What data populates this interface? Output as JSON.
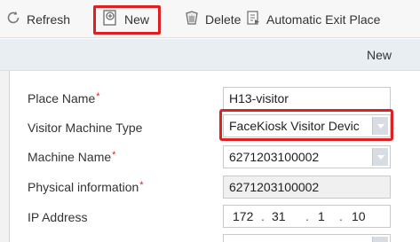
{
  "toolbar": {
    "refresh_label": "Refresh",
    "new_label": "New",
    "delete_label": "Delete",
    "exit_place_label": "Automatic Exit Place"
  },
  "panel": {
    "title": "New"
  },
  "form": {
    "place_name": {
      "label": "Place Name",
      "required": "*",
      "value": "H13-visitor"
    },
    "machine_type": {
      "label": "Visitor Machine Type",
      "value": "FaceKiosk Visitor Devic"
    },
    "machine_name": {
      "label": "Machine Name",
      "required": "*",
      "value": "6271203100002"
    },
    "physical_info": {
      "label": "Physical information",
      "required": "*",
      "value": "6271203100002"
    },
    "ip_address": {
      "label": "IP Address",
      "oct1": "172",
      "oct2": "31",
      "oct3": "1",
      "oct4": "10",
      "dot": "."
    }
  },
  "colors": {
    "highlight": "#e02020",
    "required": "#e02020",
    "toolbar_bg": "#f7f7f7",
    "header_bg": "#e9eef3"
  },
  "icons": {
    "refresh": "refresh-icon",
    "new": "new-document-icon",
    "delete": "delete-icon",
    "exit_place": "exit-place-icon"
  }
}
